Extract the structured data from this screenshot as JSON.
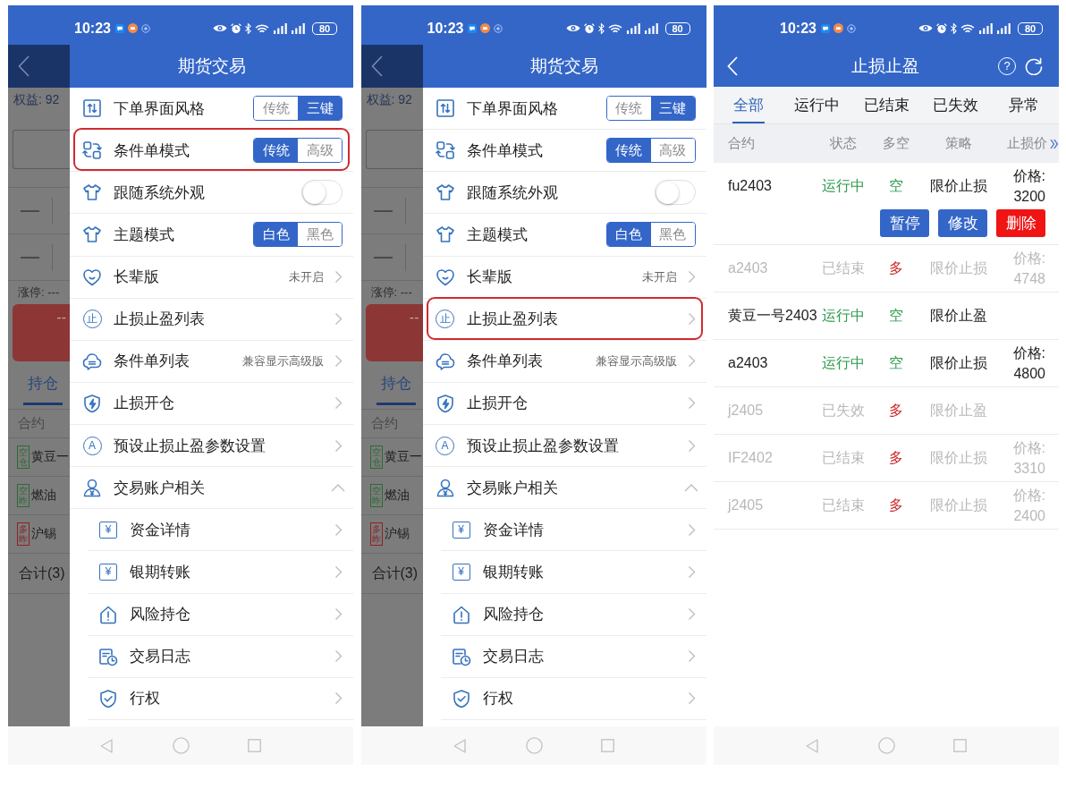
{
  "screens": [
    {
      "kind": "drawer",
      "status_bar": {
        "time": "10:23",
        "battery": "80"
      },
      "background": {
        "equity": "权益: 92",
        "limit": "涨停: ---",
        "order_button": "--",
        "tabs": [
          {
            "label": "持仓",
            "selected": true
          }
        ],
        "column": "合约",
        "positions": [
          {
            "tag": "空仓",
            "color": "#2a6b32",
            "name": "黄豆一"
          },
          {
            "tag": "空昨",
            "color": "#2a6b32",
            "name": "燃油"
          },
          {
            "tag": "多昨",
            "color": "#8c2222",
            "name": "沪锡"
          }
        ],
        "total": "合计(3)"
      },
      "drawer": {
        "title": "期货交易",
        "items": [
          {
            "kind": "segmented",
            "label": "下单界面风格",
            "highlighted": false,
            "options": [
              {
                "label": "传统",
                "selected": false
              },
              {
                "label": "三键",
                "selected": true
              }
            ]
          },
          {
            "kind": "segmented",
            "label": "条件单模式",
            "highlighted": true,
            "options": [
              {
                "label": "传统",
                "selected": true
              },
              {
                "label": "高级",
                "selected": false
              }
            ]
          },
          {
            "kind": "toggle",
            "label": "跟随系统外观",
            "highlighted": false,
            "on": false
          },
          {
            "kind": "segmented",
            "label": "主题模式",
            "highlighted": false,
            "options": [
              {
                "label": "白色",
                "selected": true
              },
              {
                "label": "黑色",
                "selected": false
              }
            ]
          },
          {
            "kind": "link",
            "label": "长辈版",
            "highlighted": false,
            "value": "未开启"
          },
          {
            "kind": "link",
            "label": "止损止盈列表",
            "highlighted": false,
            "glyph": "止"
          },
          {
            "kind": "link",
            "label": "条件单列表",
            "highlighted": false,
            "value": "兼容显示高级版"
          },
          {
            "kind": "link",
            "label": "止损开仓",
            "highlighted": false
          },
          {
            "kind": "link",
            "label": "预设止损止盈参数设置",
            "highlighted": false,
            "glyph": "A"
          },
          {
            "kind": "group",
            "label": "交易账户相关",
            "highlighted": false,
            "expanded": true,
            "children": [
              {
                "label": "资金详情",
                "glyph": "¥"
              },
              {
                "label": "银期转账",
                "glyph": "¥"
              },
              {
                "label": "风险持仓"
              },
              {
                "label": "交易日志"
              },
              {
                "label": "行权"
              }
            ]
          }
        ]
      }
    },
    {
      "kind": "drawer",
      "status_bar": {
        "time": "10:23",
        "battery": "80"
      },
      "background": {
        "equity": "权益: 92",
        "limit": "涨停: ---",
        "order_button": "--",
        "tabs": [
          {
            "label": "持仓",
            "selected": true
          }
        ],
        "column": "合约",
        "positions": [
          {
            "tag": "空仓",
            "color": "#2a6b32",
            "name": "黄豆一"
          },
          {
            "tag": "空昨",
            "color": "#2a6b32",
            "name": "燃油"
          },
          {
            "tag": "多昨",
            "color": "#8c2222",
            "name": "沪锡"
          }
        ],
        "total": "合计(3)"
      },
      "drawer": {
        "title": "期货交易",
        "items": [
          {
            "kind": "segmented",
            "label": "下单界面风格",
            "highlighted": false,
            "options": [
              {
                "label": "传统",
                "selected": false
              },
              {
                "label": "三键",
                "selected": true
              }
            ]
          },
          {
            "kind": "segmented",
            "label": "条件单模式",
            "highlighted": false,
            "options": [
              {
                "label": "传统",
                "selected": true
              },
              {
                "label": "高级",
                "selected": false
              }
            ]
          },
          {
            "kind": "toggle",
            "label": "跟随系统外观",
            "highlighted": false,
            "on": false
          },
          {
            "kind": "segmented",
            "label": "主题模式",
            "highlighted": false,
            "options": [
              {
                "label": "白色",
                "selected": true
              },
              {
                "label": "黑色",
                "selected": false
              }
            ]
          },
          {
            "kind": "link",
            "label": "长辈版",
            "highlighted": false,
            "value": "未开启"
          },
          {
            "kind": "link",
            "label": "止损止盈列表",
            "highlighted": true,
            "glyph": "止"
          },
          {
            "kind": "link",
            "label": "条件单列表",
            "highlighted": false,
            "value": "兼容显示高级版"
          },
          {
            "kind": "link",
            "label": "止损开仓",
            "highlighted": false
          },
          {
            "kind": "link",
            "label": "预设止损止盈参数设置",
            "highlighted": false,
            "glyph": "A"
          },
          {
            "kind": "group",
            "label": "交易账户相关",
            "highlighted": false,
            "expanded": true,
            "children": [
              {
                "label": "资金详情",
                "glyph": "¥"
              },
              {
                "label": "银期转账",
                "glyph": "¥"
              },
              {
                "label": "风险持仓"
              },
              {
                "label": "交易日志"
              },
              {
                "label": "行权"
              }
            ]
          }
        ]
      }
    },
    {
      "kind": "list",
      "status_bar": {
        "time": "10:23",
        "battery": "80"
      },
      "header": {
        "title": "止损止盈",
        "help": "?"
      },
      "tabs": [
        {
          "label": "全部",
          "selected": true
        },
        {
          "label": "运行中",
          "selected": false
        },
        {
          "label": "已结束",
          "selected": false
        },
        {
          "label": "已失效",
          "selected": false
        },
        {
          "label": "异常",
          "selected": false
        }
      ],
      "table": {
        "columns": [
          "合约",
          "状态",
          "多空",
          "策略",
          "止损价"
        ],
        "rows": [
          {
            "contract": "fu2403",
            "status": "运行中",
            "direction": {
              "text": "空",
              "color": "#2b9a4b"
            },
            "strategy": "限价止损",
            "price_label": "价格:",
            "price": "3200",
            "active": true,
            "actions": [
              {
                "label": "暂停",
                "kind": "pause"
              },
              {
                "label": "修改",
                "kind": "edit"
              },
              {
                "label": "删除",
                "kind": "delete"
              }
            ]
          },
          {
            "contract": "a2403",
            "status": "已结束",
            "direction": {
              "text": "多",
              "color": "#cc2a2a"
            },
            "strategy": "限价止损",
            "price_label": "价格:",
            "price": "4748",
            "active": false
          },
          {
            "contract": "黄豆一号2403",
            "status": "运行中",
            "direction": {
              "text": "空",
              "color": "#2b9a4b"
            },
            "strategy": "限价止盈",
            "active": true
          },
          {
            "contract": "a2403",
            "status": "运行中",
            "direction": {
              "text": "空",
              "color": "#2b9a4b"
            },
            "strategy": "限价止损",
            "price_label": "价格:",
            "price": "4800",
            "active": true
          },
          {
            "contract": "j2405",
            "status": "已失效",
            "direction": {
              "text": "多",
              "color": "#cc2a2a"
            },
            "strategy": "限价止盈",
            "active": false
          },
          {
            "contract": "IF2402",
            "status": "已结束",
            "direction": {
              "text": "多",
              "color": "#cc2a2a"
            },
            "strategy": "限价止损",
            "price_label": "价格:",
            "price": "3310",
            "active": false
          },
          {
            "contract": "j2405",
            "status": "已结束",
            "direction": {
              "text": "多",
              "color": "#cc2a2a"
            },
            "strategy": "限价止损",
            "price_label": "价格:",
            "price": "2400",
            "active": false
          }
        ]
      }
    }
  ]
}
